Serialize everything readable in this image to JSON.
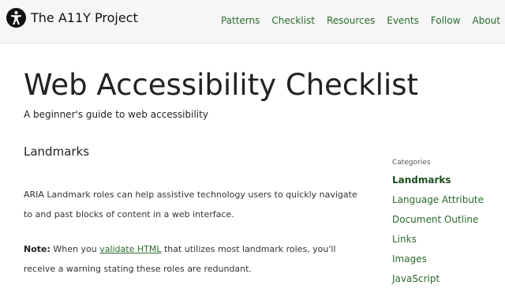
{
  "brand": {
    "logo_icon": "accessibility-person-icon",
    "name": "The A11Y Project"
  },
  "nav": {
    "items": [
      "Patterns",
      "Checklist",
      "Resources",
      "Events",
      "Follow",
      "About"
    ]
  },
  "main": {
    "title": "Web Accessibility Checklist",
    "subtitle": "A beginner's guide to web accessibility",
    "section_heading": "Landmarks",
    "para1": "ARIA Landmark roles can help assistive technology users to quickly navigate to and past blocks of content in a web interface.",
    "note": {
      "label": "Note:",
      "before": "When you",
      "link": "validate HTML",
      "after": "that utilizes most landmark roles, you'll receive a warning stating these roles are redundant."
    }
  },
  "sidebar": {
    "label": "Categories",
    "items": [
      "Landmarks",
      "Language Attribute",
      "Document Outline",
      "Links",
      "Images",
      "JavaScript"
    ],
    "active": "Landmarks"
  },
  "colors": {
    "link": "#2b6b2b",
    "header_bg": "#f6f6f6",
    "text": "#222222"
  }
}
